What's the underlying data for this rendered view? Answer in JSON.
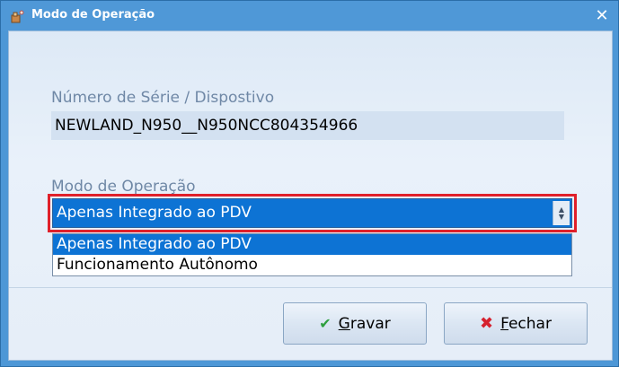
{
  "window": {
    "title": "Modo de Operação",
    "title_icon": "app-icon",
    "close_glyph": "✕"
  },
  "form": {
    "serial_label": "Número de Série / Dispostivo",
    "serial_value": "NEWLAND_N950__N950NCC804354966",
    "mode_label": "Modo de Operação",
    "mode_selected": "Apenas Integrado ao PDV",
    "mode_options": [
      "Apenas Integrado ao PDV",
      "Funcionamento Autônomo"
    ]
  },
  "buttons": {
    "save_label_first": "G",
    "save_label_rest": "ravar",
    "save_icon": "check-icon",
    "close_label_first": "F",
    "close_label_rest": "echar",
    "close_icon": "x-icon"
  },
  "colors": {
    "titlebar": "#4f98d7",
    "selection": "#0d73d4",
    "highlight_border": "#e0202a",
    "label_text": "#6f88a6"
  }
}
